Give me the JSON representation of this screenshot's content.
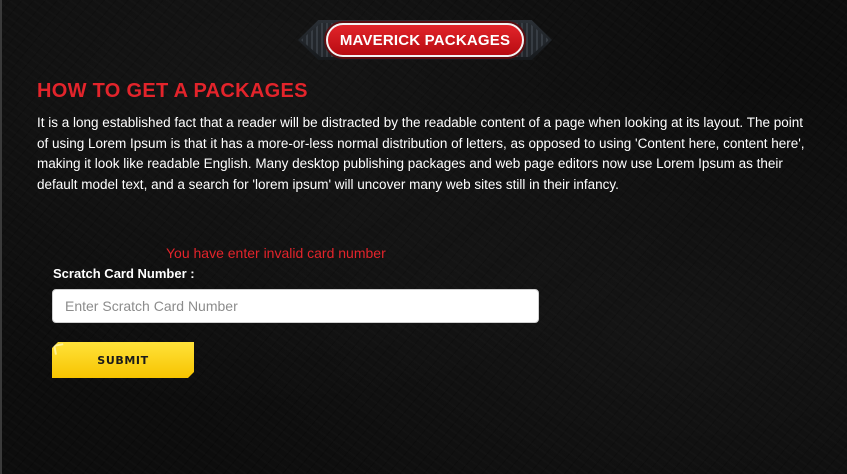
{
  "banner": {
    "title": "MAVERICK PACKAGES"
  },
  "section": {
    "heading": "HOW TO GET A PACKAGES",
    "description": "It is a long established fact that a reader will be distracted by the readable content of a page when looking at its layout. The point of using Lorem Ipsum is that it has a more-or-less normal distribution of letters, as opposed to using 'Content here, content here', making it look like readable English. Many desktop publishing packages and web page editors now use Lorem Ipsum as their default model text, and a search for 'lorem ipsum' will uncover many web sites still in their infancy."
  },
  "form": {
    "error_message": "You have enter invalid card number",
    "label": "Scratch Card Number :",
    "input_value": "",
    "placeholder": "Enter Scratch Card Number",
    "submit_label": "SUBMIT"
  },
  "colors": {
    "accent_red": "#e3242b",
    "button_yellow": "#ffd60a",
    "background": "#0d0d0d"
  }
}
